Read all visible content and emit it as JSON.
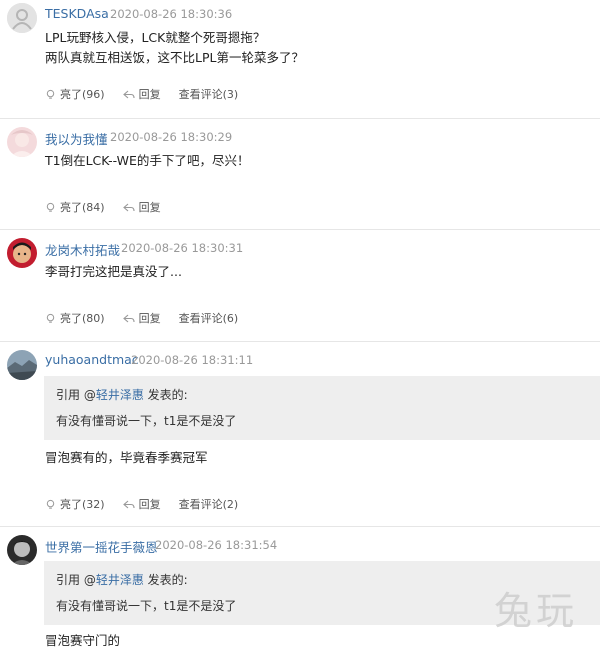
{
  "comments": [
    {
      "username": "TESKDAsa",
      "time": "2020-08-26 18:30:36",
      "lines": [
        "LPL玩野核入侵，LCK就整个死哥摁拖？",
        "两队真就互相送饭，这不比LPL第一轮菜多了？"
      ],
      "likes": "亮了(96)",
      "reply": "回复",
      "view": "查看评论(3)"
    },
    {
      "username": "我以为我懂",
      "time": "2020-08-26 18:30:29",
      "lines": [
        "T1倒在LCK--WE的手下了吧，尽兴！"
      ],
      "likes": "亮了(84)",
      "reply": "回复"
    },
    {
      "username": "龙岗木村拓哉",
      "time": "2020-08-26 18:30:31",
      "lines": [
        "李哥打完这把是真没了..."
      ],
      "likes": "亮了(80)",
      "reply": "回复",
      "view": "查看评论(6)"
    },
    {
      "username": "yuhaoandtmac",
      "time": "2020-08-26 18:31:11",
      "quote": {
        "prefix": "引用 @",
        "name": "轻井泽惠",
        "suffix": " 发表的:",
        "text": "有没有懂哥说一下，t1是不是没了"
      },
      "lines": [
        "冒泡赛有的，毕竟春季赛冠军"
      ],
      "likes": "亮了(32)",
      "reply": "回复",
      "view": "查看评论(2)"
    },
    {
      "username": "世界第一摇花手薇恩",
      "time": "2020-08-26 18:31:54",
      "quote": {
        "prefix": "引用 @",
        "name": "轻井泽惠",
        "suffix": " 发表的:",
        "text": "有没有懂哥说一下，t1是不是没了"
      },
      "lines": [
        "冒泡赛守门的"
      ]
    }
  ],
  "watermark": "兔玩"
}
